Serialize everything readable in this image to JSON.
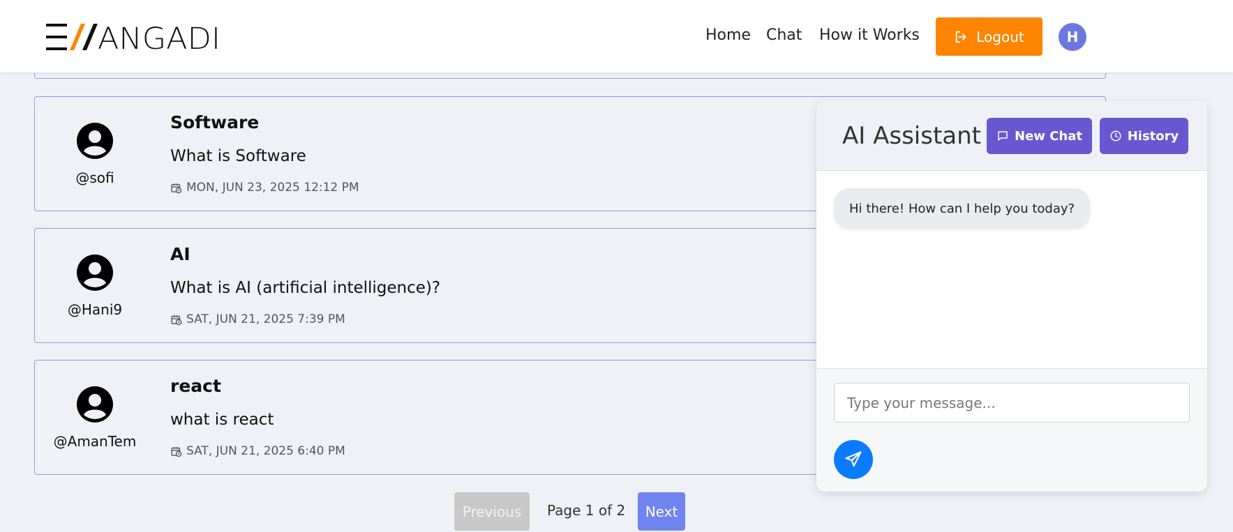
{
  "header": {
    "logo_text": "EVANGADI",
    "nav": [
      {
        "label": "Home"
      },
      {
        "label": "Chat"
      },
      {
        "label": "How it Works"
      }
    ],
    "logout_label": "Logout",
    "avatar_initial": "H",
    "accent_color": "#fe8402"
  },
  "questions": [
    {
      "username": "@sofi",
      "title": "Software",
      "body": "What is Software",
      "date": "MON, JUN 23, 2025 12:12 PM"
    },
    {
      "username": "@Hani9",
      "title": "AI",
      "body": "What is AI (artificial intelligence)?",
      "date": "SAT, JUN 21, 2025 7:39 PM"
    },
    {
      "username": "@AmanTem",
      "title": "react",
      "body": "what is react",
      "date": "SAT, JUN 21, 2025 6:40 PM"
    }
  ],
  "pagination": {
    "prev_label": "Previous",
    "page_info": "Page 1 of 2",
    "next_label": "Next"
  },
  "assistant": {
    "title": "AI Assistant",
    "new_chat_label": "New Chat",
    "history_label": "History",
    "greeting": "Hi there! How can I help you today?",
    "input_placeholder": "Type your message...",
    "input_value": "",
    "accent_color": "#6a57d0",
    "send_color": "#0b7bfd"
  }
}
